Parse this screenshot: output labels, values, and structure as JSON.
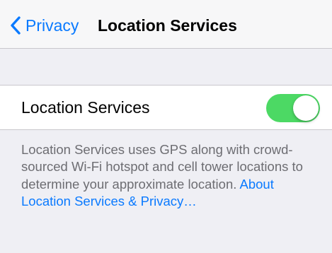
{
  "nav": {
    "back_label": "Privacy",
    "title": "Location Services"
  },
  "settings": {
    "location_services": {
      "label": "Location Services",
      "enabled": true
    }
  },
  "footer": {
    "description": "Location Services uses GPS along with crowd-sourced Wi-Fi hotspot and cell tower locations to determine your approximate location.",
    "link_text": "About Location Services & Privacy…"
  },
  "colors": {
    "accent": "#0a7aff",
    "toggle_on": "#4cd964",
    "background": "#efeff4",
    "footer_text": "#6d6d72"
  },
  "icons": {
    "back": "chevron-left-icon"
  }
}
